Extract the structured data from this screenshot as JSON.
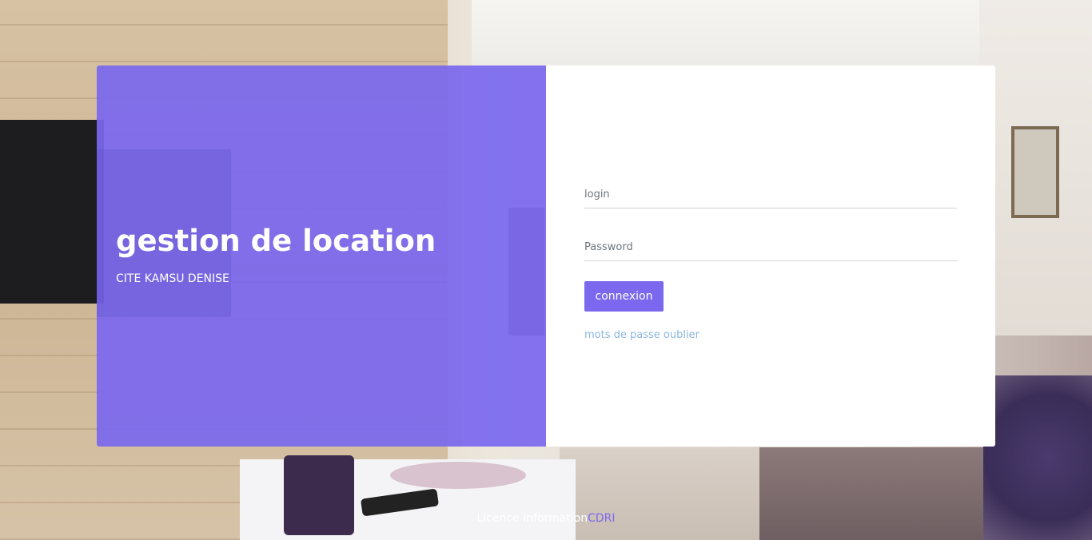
{
  "hero": {
    "title": "gestion de location",
    "subtitle": "CITE KAMSU DENISE"
  },
  "form": {
    "login_placeholder": "login",
    "password_placeholder": "Password",
    "submit_label": "connexion",
    "forgot_link": "mots de passe oublier"
  },
  "footer": {
    "text": "Licence Information",
    "link_label": "CDRI"
  },
  "colors": {
    "accent": "#7b68ee",
    "link": "#8bb7e0"
  }
}
